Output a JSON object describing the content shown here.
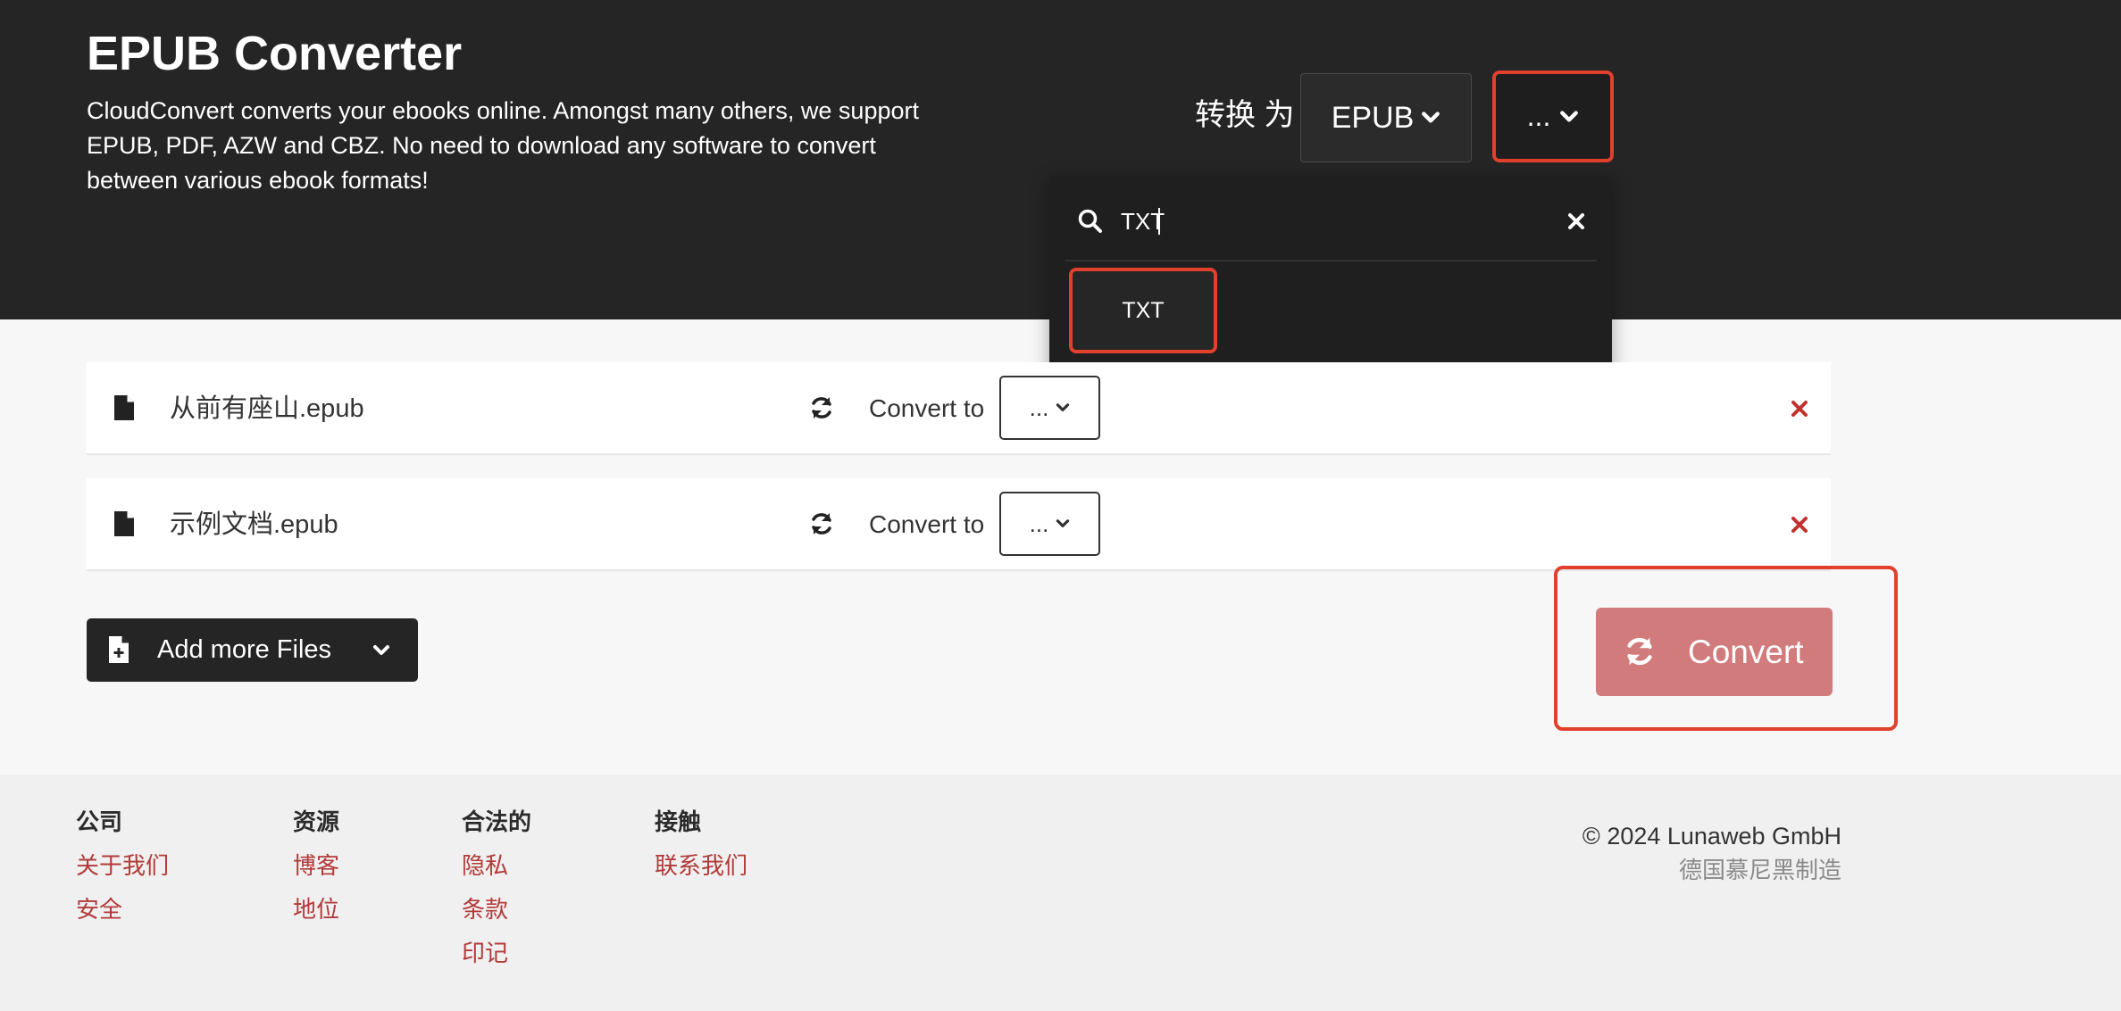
{
  "header": {
    "title": "EPUB Converter",
    "description": "CloudConvert converts your ebooks online. Amongst many others, we support EPUB, PDF, AZW and CBZ. No need to download any software to convert between various ebook formats!",
    "convert_label": "转换 为",
    "source_format": "EPUB",
    "target_placeholder": "..."
  },
  "dropdown": {
    "search_value": "TXT",
    "options": [
      {
        "label": "TXT"
      }
    ]
  },
  "files": [
    {
      "name": "从前有座山.epub",
      "convert_label": "Convert to",
      "target": "..."
    },
    {
      "name": "示例文档.epub",
      "convert_label": "Convert to",
      "target": "..."
    }
  ],
  "actions": {
    "add_files_label": "Add more Files",
    "convert_label": "Convert"
  },
  "footer": {
    "columns": [
      {
        "heading": "公司",
        "links": [
          "关于我们",
          "安全"
        ]
      },
      {
        "heading": "资源",
        "links": [
          "博客",
          "地位"
        ]
      },
      {
        "heading": "合法的",
        "links": [
          "隐私",
          "条款",
          "印记"
        ]
      },
      {
        "heading": "接触",
        "links": [
          "联系我们"
        ]
      }
    ],
    "copyright": "© 2024 Lunaweb GmbH",
    "made_in": "德国慕尼黑制造"
  },
  "colors": {
    "header_bg": "#252525",
    "accent_red": "#e0402c",
    "convert_button": "#d27b7c",
    "link": "#b23a3a"
  },
  "icons": {
    "file": "file-icon",
    "refresh": "refresh-icon",
    "remove": "close-icon",
    "search": "search-icon",
    "chevron": "chevron-down-icon",
    "add_file": "file-plus-icon"
  }
}
